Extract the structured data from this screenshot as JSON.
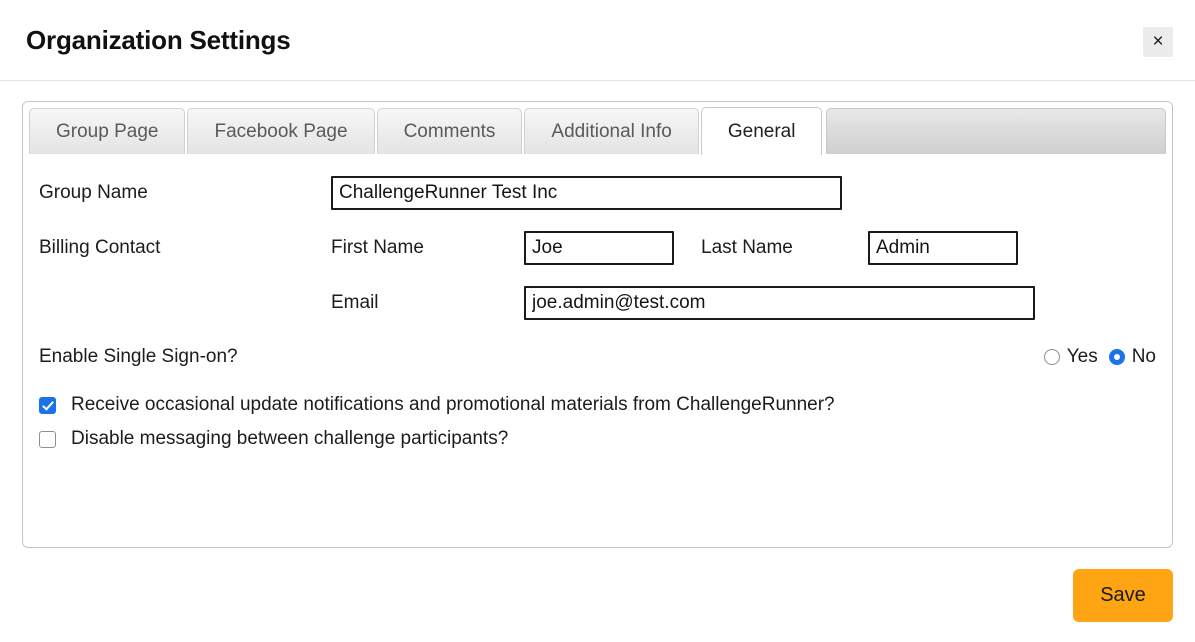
{
  "dialog": {
    "title": "Organization Settings",
    "close_label": "×"
  },
  "tabs": [
    {
      "label": "Group Page",
      "active": false
    },
    {
      "label": "Facebook Page",
      "active": false
    },
    {
      "label": "Comments",
      "active": false
    },
    {
      "label": "Additional Info",
      "active": false
    },
    {
      "label": "General",
      "active": true
    }
  ],
  "form": {
    "group_name": {
      "label": "Group Name",
      "value": "ChallengeRunner Test Inc",
      "placeholder": ""
    },
    "billing_contact": {
      "label": "Billing Contact",
      "first_name": {
        "label": "First Name",
        "value": "Joe",
        "placeholder": ""
      },
      "last_name": {
        "label": "Last Name",
        "value": "Admin",
        "placeholder": ""
      },
      "email": {
        "label": "Email",
        "value": "joe.admin@test.com",
        "placeholder": ""
      }
    },
    "single_sign_on": {
      "label": "Enable Single Sign-on?",
      "options": [
        "Yes",
        "No"
      ],
      "yes_label": "Yes",
      "no_label": "No",
      "selected": "No"
    },
    "checkboxes": [
      {
        "label": "Receive occasional update notifications and promotional materials from ChallengeRunner?",
        "checked": true
      },
      {
        "label": "Disable messaging between challenge participants?",
        "checked": false
      }
    ]
  },
  "footer": {
    "save_label": "Save"
  },
  "colors": {
    "accent_orange": "#ffa412",
    "control_blue": "#1a73e8",
    "header_divider": "#e3e3e3"
  }
}
